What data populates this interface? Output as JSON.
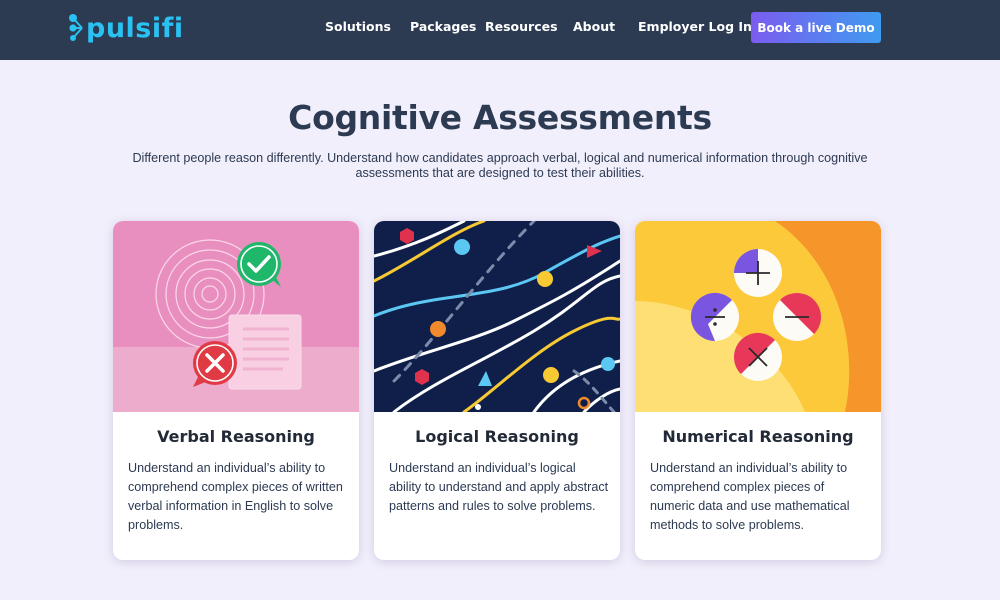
{
  "brand": {
    "name": "pulsifi",
    "accent": "#29c2f2"
  },
  "nav": {
    "items": [
      "Solutions",
      "Packages",
      "Resources",
      "About",
      "Employer Log In"
    ],
    "cta": "Book a live Demo"
  },
  "hero": {
    "title": "Cognitive Assessments",
    "subtitle": "Different people reason differently. Understand how candidates approach verbal, logical and numerical information through cognitive assessments that are designed to test their abilities."
  },
  "cards": [
    {
      "title": "Verbal Reasoning",
      "text": "Understand an individual’s ability to comprehend complex pieces of written verbal information in English to solve problems."
    },
    {
      "title": "Logical Reasoning",
      "text": "Understand an individual’s logical ability to understand and apply abstract patterns and rules to solve problems."
    },
    {
      "title": "Numerical Reasoning",
      "text": "Understand an individual’s ability to comprehend complex pieces of numeric data and use mathematical methods to solve problems."
    }
  ],
  "colors": {
    "header_bg": "#2c3a52",
    "page_bg": "#f2effc",
    "verbal_bg": "#e98fbf",
    "logical_bg": "#0f1f4a",
    "numerical_bg": "#fcc93a"
  }
}
